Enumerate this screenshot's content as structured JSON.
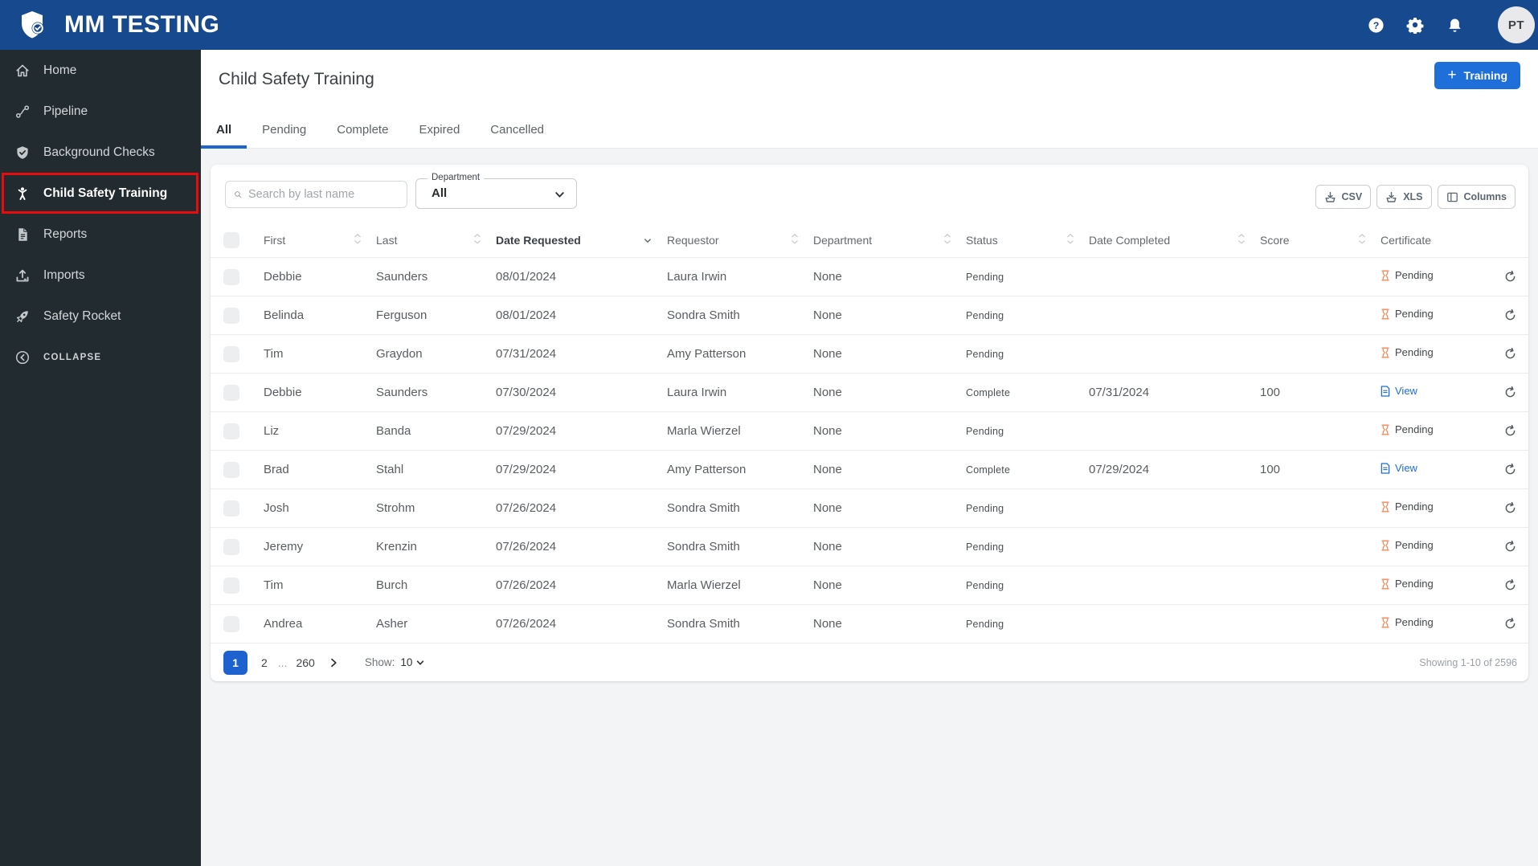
{
  "appbar": {
    "title": "MM TESTING",
    "avatar_initials": "PT"
  },
  "sidebar": {
    "items": [
      {
        "label": "Home"
      },
      {
        "label": "Pipeline"
      },
      {
        "label": "Background Checks"
      },
      {
        "label": "Child Safety Training",
        "active": true
      },
      {
        "label": "Reports"
      },
      {
        "label": "Imports"
      },
      {
        "label": "Safety Rocket"
      }
    ],
    "collapse_label": "COLLAPSE"
  },
  "page": {
    "title": "Child Safety Training",
    "add_button_label": "Training",
    "tabs": [
      "All",
      "Pending",
      "Complete",
      "Expired",
      "Cancelled"
    ],
    "active_tab": "All"
  },
  "toolbar": {
    "search_placeholder": "Search by last name",
    "department_label": "Department",
    "department_value": "All",
    "csv_label": "CSV",
    "xls_label": "XLS",
    "columns_label": "Columns"
  },
  "table": {
    "headers": [
      "First",
      "Last",
      "Date Requested",
      "Requestor",
      "Department",
      "Status",
      "Date Completed",
      "Score",
      "Certificate"
    ],
    "sorted_by": "Date Requested",
    "sort_direction": "desc",
    "rows": [
      {
        "first": "Debbie",
        "last": "Saunders",
        "date_requested": "08/01/2024",
        "requestor": "Laura Irwin",
        "department": "None",
        "status": "Pending",
        "date_completed": "",
        "score": "",
        "certificate": {
          "type": "pending",
          "label": "Pending"
        }
      },
      {
        "first": "Belinda",
        "last": "Ferguson",
        "date_requested": "08/01/2024",
        "requestor": "Sondra Smith",
        "department": "None",
        "status": "Pending",
        "date_completed": "",
        "score": "",
        "certificate": {
          "type": "pending",
          "label": "Pending"
        }
      },
      {
        "first": "Tim",
        "last": "Graydon",
        "date_requested": "07/31/2024",
        "requestor": "Amy Patterson",
        "department": "None",
        "status": "Pending",
        "date_completed": "",
        "score": "",
        "certificate": {
          "type": "pending",
          "label": "Pending"
        }
      },
      {
        "first": "Debbie",
        "last": "Saunders",
        "date_requested": "07/30/2024",
        "requestor": "Laura Irwin",
        "department": "None",
        "status": "Complete",
        "date_completed": "07/31/2024",
        "score": "100",
        "certificate": {
          "type": "view",
          "label": "View"
        }
      },
      {
        "first": "Liz",
        "last": "Banda",
        "date_requested": "07/29/2024",
        "requestor": "Marla Wierzel",
        "department": "None",
        "status": "Pending",
        "date_completed": "",
        "score": "",
        "certificate": {
          "type": "pending",
          "label": "Pending"
        }
      },
      {
        "first": "Brad",
        "last": "Stahl",
        "date_requested": "07/29/2024",
        "requestor": "Amy Patterson",
        "department": "None",
        "status": "Complete",
        "date_completed": "07/29/2024",
        "score": "100",
        "certificate": {
          "type": "view",
          "label": "View"
        }
      },
      {
        "first": "Josh",
        "last": "Strohm",
        "date_requested": "07/26/2024",
        "requestor": "Sondra Smith",
        "department": "None",
        "status": "Pending",
        "date_completed": "",
        "score": "",
        "certificate": {
          "type": "pending",
          "label": "Pending"
        }
      },
      {
        "first": "Jeremy",
        "last": "Krenzin",
        "date_requested": "07/26/2024",
        "requestor": "Sondra Smith",
        "department": "None",
        "status": "Pending",
        "date_completed": "",
        "score": "",
        "certificate": {
          "type": "pending",
          "label": "Pending"
        }
      },
      {
        "first": "Tim",
        "last": "Burch",
        "date_requested": "07/26/2024",
        "requestor": "Marla Wierzel",
        "department": "None",
        "status": "Pending",
        "date_completed": "",
        "score": "",
        "certificate": {
          "type": "pending",
          "label": "Pending"
        }
      },
      {
        "first": "Andrea",
        "last": "Asher",
        "date_requested": "07/26/2024",
        "requestor": "Sondra Smith",
        "department": "None",
        "status": "Pending",
        "date_completed": "",
        "score": "",
        "certificate": {
          "type": "pending",
          "label": "Pending"
        }
      }
    ]
  },
  "pagination": {
    "active_page": "1",
    "page2": "2",
    "ellipsis": "...",
    "last_page": "260",
    "show_label": "Show:",
    "show_value": "10",
    "summary": "Showing 1-10 of 2596"
  },
  "icons": {
    "appbar": [
      "help-icon",
      "gear-icon",
      "bell-icon"
    ],
    "certificate_pending": "hourglass-icon",
    "certificate_view": "document-icon",
    "row_action": "refresh-icon"
  },
  "colors": {
    "appbar_bg": "#17498e",
    "sidebar_bg": "#222b30",
    "accent_blue": "#1d66cf",
    "button_blue": "#1e6fd9",
    "active_highlight_red": "#ea0c0c",
    "pending_icon_orange": "#ef8a5e",
    "page_bg": "#f3f4f6"
  }
}
